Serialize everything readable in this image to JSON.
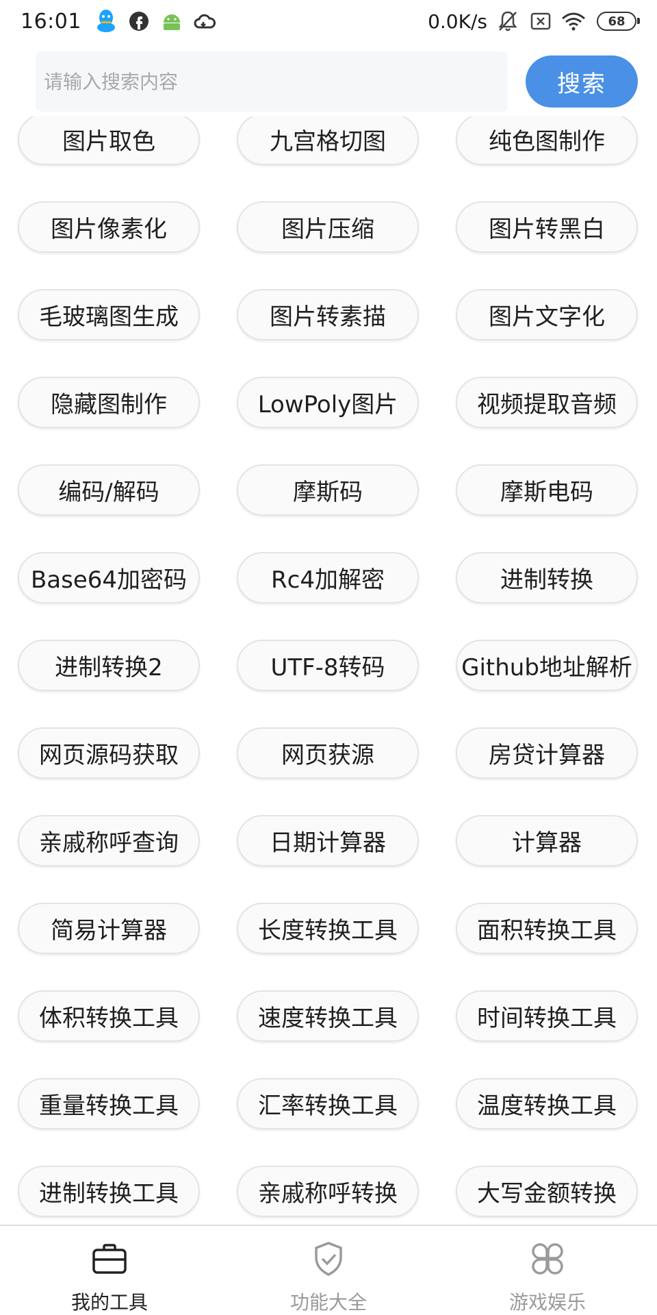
{
  "status_bar": {
    "time": "16:01",
    "net_speed": "0.0K/s",
    "battery": "68",
    "icons": [
      "qq-icon",
      "facebook-icon",
      "android-icon",
      "cloud-icon",
      "bell-off-icon",
      "sim-off-icon",
      "wifi-icon",
      "battery-icon"
    ],
    "qq_color": "#1aa3ff"
  },
  "search": {
    "placeholder": "请输入搜索内容",
    "value": "",
    "button_label": "搜索",
    "button_color": "#4a90e6"
  },
  "tools": [
    "图片取色",
    "九宫格切图",
    "纯色图制作",
    "图片像素化",
    "图片压缩",
    "图片转黑白",
    "毛玻璃图生成",
    "图片转素描",
    "图片文字化",
    "隐藏图制作",
    "LowPoly图片",
    "视频提取音频",
    "编码/解码",
    "摩斯码",
    "摩斯电码",
    "Base64加密码",
    "Rc4加解密",
    "进制转换",
    "进制转换2",
    "UTF-8转码",
    "Github地址解析",
    "网页源码获取",
    "网页获源",
    "房贷计算器",
    "亲戚称呼查询",
    "日期计算器",
    "计算器",
    "简易计算器",
    "长度转换工具",
    "面积转换工具",
    "体积转换工具",
    "速度转换工具",
    "时间转换工具",
    "重量转换工具",
    "汇率转换工具",
    "温度转换工具",
    "进制转换工具",
    "亲戚称呼转换",
    "大写金额转换"
  ],
  "bottom_nav": {
    "items": [
      {
        "label": "我的工具",
        "icon": "toolbox-icon",
        "active": true
      },
      {
        "label": "功能大全",
        "icon": "shield-check-icon",
        "active": false
      },
      {
        "label": "游戏娱乐",
        "icon": "grid-flower-icon",
        "active": false
      }
    ]
  }
}
